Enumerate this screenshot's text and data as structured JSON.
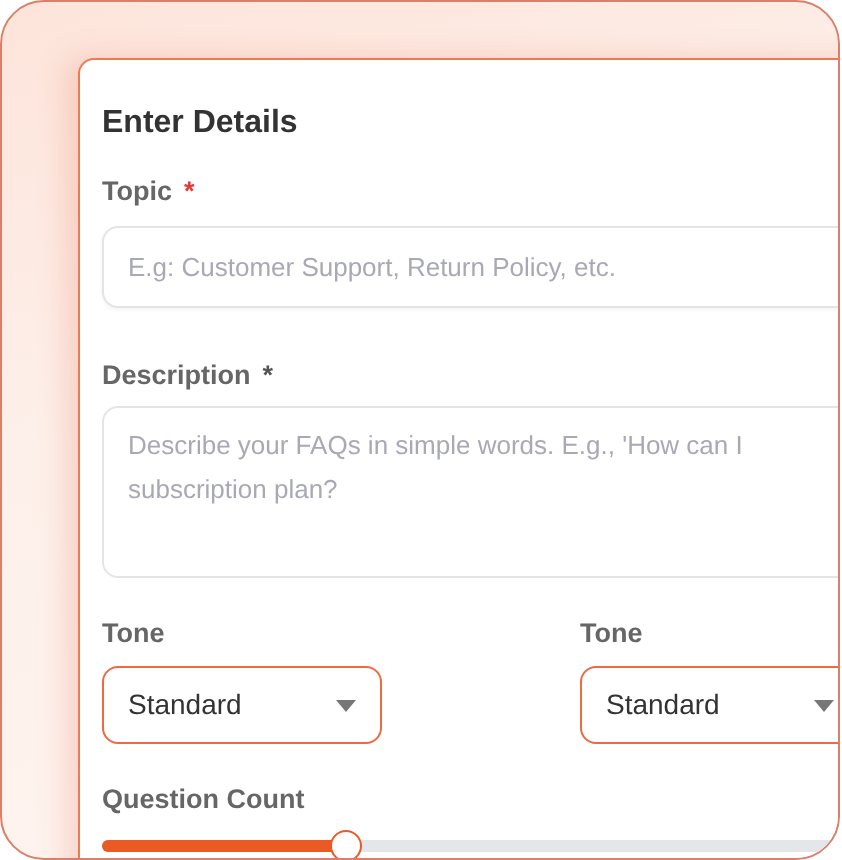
{
  "title": "Enter Details",
  "topic": {
    "label": "Topic",
    "required_mark": "*",
    "placeholder": "E.g: Customer Support, Return Policy, etc."
  },
  "description": {
    "label": "Description",
    "required_mark": "*",
    "placeholder": "Describe your FAQs in simple words. E.g., 'How can I\nsubscription plan?"
  },
  "selects": [
    {
      "label": "Tone",
      "value": "Standard"
    },
    {
      "label": "Tone",
      "value": "Standard"
    }
  ],
  "question_count": {
    "label": "Question Count",
    "level": 0.29
  }
}
